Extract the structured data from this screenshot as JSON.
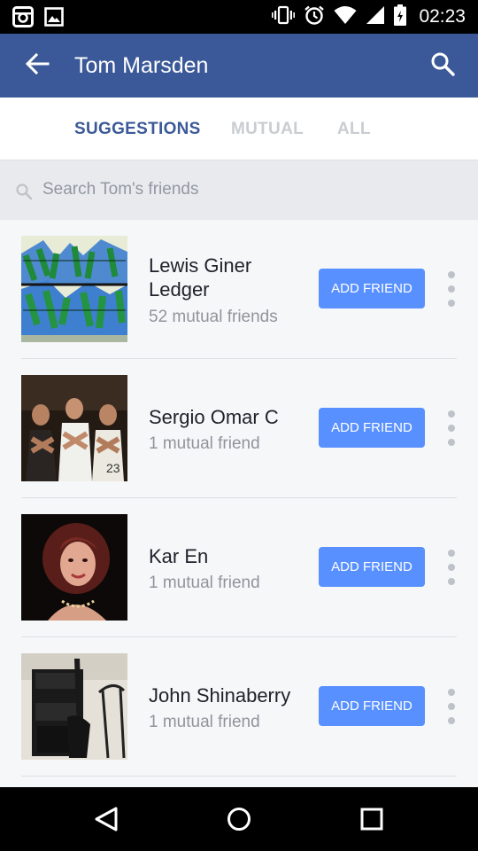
{
  "status_bar": {
    "time": "02:23",
    "left_icons": [
      "instagram-icon",
      "gallery-icon"
    ],
    "right_icons": [
      "vibrate-icon",
      "alarm-icon",
      "wifi-icon",
      "signal-icon",
      "battery-icon"
    ]
  },
  "app_bar": {
    "title": "Tom Marsden",
    "back_icon": "arrow-left-icon",
    "search_icon": "search-icon"
  },
  "tabs": [
    {
      "label": "SUGGESTIONS",
      "active": true
    },
    {
      "label": "MUTUAL",
      "active": false
    },
    {
      "label": "ALL",
      "active": false
    }
  ],
  "search": {
    "placeholder": "Search Tom's friends",
    "value": ""
  },
  "friends": [
    {
      "name": "Lewis Giner Ledger",
      "mutual": "52 mutual friends",
      "button_label": "ADD FRIEND",
      "avatar": "graffiti-art-avatar"
    },
    {
      "name": "Sergio Omar C",
      "mutual": "1 mutual friend",
      "button_label": "ADD FRIEND",
      "avatar": "group-photo-avatar"
    },
    {
      "name": "Kar En",
      "mutual": "1 mutual friend",
      "button_label": "ADD FRIEND",
      "avatar": "portrait-avatar"
    },
    {
      "name": "John Shinaberry",
      "mutual": "1 mutual friend",
      "button_label": "ADD FRIEND",
      "avatar": "guitar-amp-avatar"
    }
  ],
  "colors": {
    "brand": "#3b5998",
    "button": "#5890ff",
    "tab_inactive": "#c9ccd1"
  },
  "nav_bar": {
    "icons": [
      "back-triangle-icon",
      "home-circle-icon",
      "recents-square-icon"
    ]
  }
}
